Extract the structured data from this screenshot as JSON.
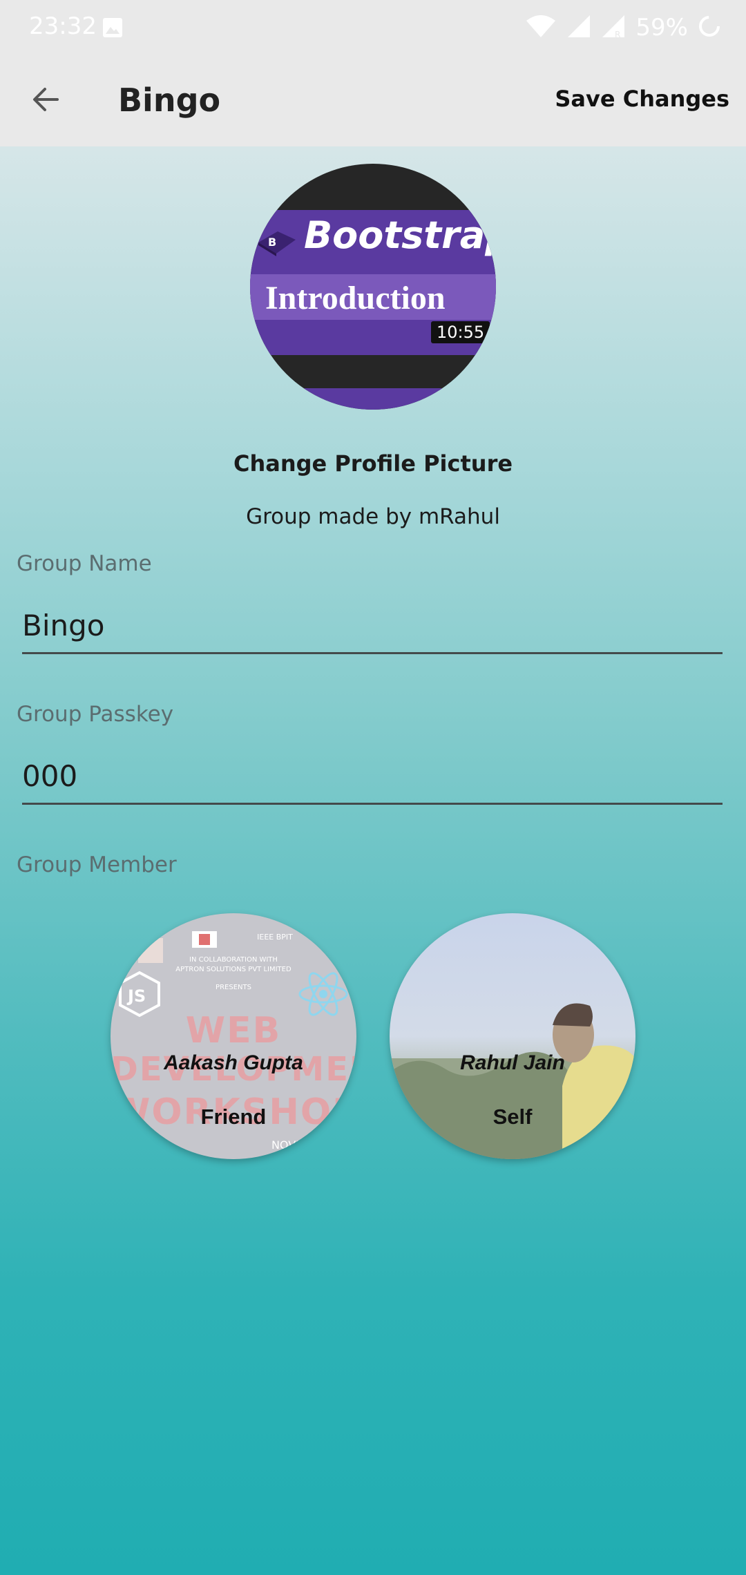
{
  "status_bar": {
    "time": "23:32",
    "battery": "59%"
  },
  "app_bar": {
    "title": "Bingo",
    "save_label": "Save Changes"
  },
  "profile": {
    "thumbnail_title": "Bootstrap",
    "thumbnail_subtitle": "Introduction",
    "thumbnail_duration": "10:55",
    "change_picture_label": "Change Profile Picture",
    "made_by": "Group made by mRahul"
  },
  "form": {
    "group_name_label": "Group Name",
    "group_name_value": "Bingo",
    "group_passkey_label": "Group Passkey",
    "group_passkey_value": "000",
    "group_member_label": "Group Member"
  },
  "members": [
    {
      "name": "Aakash Gupta",
      "role": "Friend",
      "poster": {
        "org": "IEEE BPIT",
        "line1": "IN COLLABORATION WITH",
        "line2": "APTRON SOLUTIONS PVT LIMITED",
        "presents": "PRESENTS",
        "word1": "WEB",
        "word2": "DEVELOPMENT",
        "word3": "WORKSHOP",
        "footer": "NOVEMB"
      }
    },
    {
      "name": "Rahul Jain",
      "role": "Self"
    }
  ],
  "colors": {
    "gradient_top": "#d6e6e8",
    "gradient_bottom": "#20adb2",
    "app_bar_bg": "#e9e9e9",
    "thumbnail_purple": "#5a3aa0"
  }
}
